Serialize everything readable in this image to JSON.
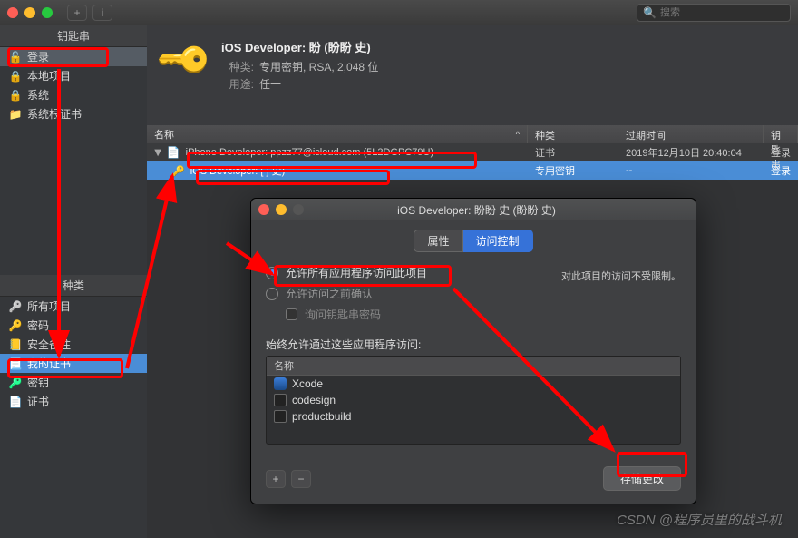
{
  "search_placeholder": "搜索",
  "sidebar": {
    "header1": "钥匙串",
    "items": [
      {
        "label": "登录",
        "icon": "lock-open"
      },
      {
        "label": "本地项目",
        "icon": "lock-closed"
      },
      {
        "label": "系统",
        "icon": "lock-closed"
      },
      {
        "label": "系统根证书",
        "icon": "folder"
      }
    ],
    "header2": "种类",
    "cats": [
      {
        "label": "所有项目",
        "icon": "cat-all"
      },
      {
        "label": "密码",
        "icon": "cat-pw"
      },
      {
        "label": "安全备注",
        "icon": "cat-note"
      },
      {
        "label": "我的证书",
        "icon": "cat-cert"
      },
      {
        "label": "密钥",
        "icon": "cat-key"
      },
      {
        "label": "证书",
        "icon": "cat-files"
      }
    ]
  },
  "detail": {
    "title": "iOS Developer: 盼     (盼盼 史)",
    "row1_label": "种类:",
    "row1_val": "专用密钥, RSA, 2,048 位",
    "row2_label": "用途:",
    "row2_val": "任一"
  },
  "table": {
    "headers": {
      "name": "名称",
      "kind": "种类",
      "exp": "过期时间",
      "kc": "钥匙串"
    },
    "rows": [
      {
        "name": "iPhone Developer: ppzz77@icloud.com (5L2DGPC79U)",
        "kind": "证书",
        "exp": "2019年12月10日 20:40:04",
        "kc": "登录",
        "icon": "certicon",
        "indent": 0,
        "open": true
      },
      {
        "name": "iOS Developer: [            ] 史)",
        "kind": "专用密钥",
        "exp": "--",
        "kc": "登录",
        "icon": "keyicon-s",
        "indent": 1
      }
    ]
  },
  "dialog": {
    "title": "iOS Developer: 盼盼 史 (盼盼 史)",
    "tabs": {
      "attr": "属性",
      "access": "访问控制"
    },
    "radio1": "允许所有应用程序访问此项目",
    "note": "对此项目的访问不受限制。",
    "radio2": "允许访问之前确认",
    "chk_label": "询问钥匙串密码",
    "section": "始终允许通过这些应用程序访问:",
    "apphead": "名称",
    "apps": [
      "Xcode",
      "codesign",
      "productbuild"
    ],
    "save": "存储更改"
  },
  "watermark": "CSDN @程序员里的战斗机"
}
